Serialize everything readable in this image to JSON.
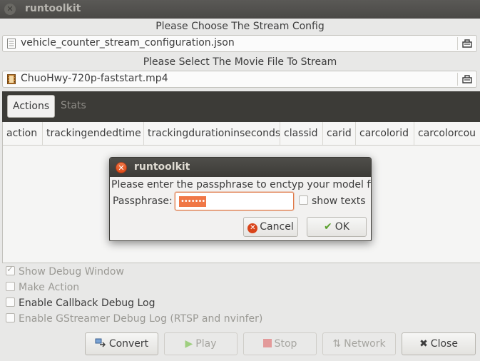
{
  "window": {
    "title": "runtoolkit"
  },
  "stream_config": {
    "label": "Please Choose The Stream Config",
    "file": "vehicle_counter_stream_configuration.json"
  },
  "movie": {
    "label": "Please Select The Movie File To Stream",
    "file": "ChuoHwy-720p-faststart.mp4"
  },
  "tabs": [
    {
      "label": "Actions",
      "active": true
    },
    {
      "label": "Stats",
      "active": false
    }
  ],
  "table": {
    "columns": [
      "action",
      "trackingendedtime",
      "trackingdurationinseconds",
      "classid",
      "carid",
      "carcolorid",
      "carcolorcou"
    ]
  },
  "options": [
    {
      "label": "Show Debug Window",
      "checked": true,
      "enabled": false
    },
    {
      "label": "Make Action",
      "checked": false,
      "enabled": false
    },
    {
      "label": "Enable Callback Debug Log",
      "checked": false,
      "enabled": true
    },
    {
      "label": "Enable GStreamer Debug Log (RTSP and nvinfer)",
      "checked": false,
      "enabled": false
    }
  ],
  "buttons": {
    "convert": "Convert",
    "play": "Play",
    "stop": "Stop",
    "network": "Network",
    "close": "Close"
  },
  "dialog": {
    "title": "runtoolkit",
    "message": "Please enter the passphrase to enctyp your model files",
    "passphrase_label": "Passphrase:",
    "passphrase_value": "•••••••",
    "show_texts_label": "show texts",
    "cancel_label": "Cancel",
    "ok_label": "OK"
  },
  "colors": {
    "accent": "#f07746",
    "dark_bar": "#3c3b37"
  }
}
